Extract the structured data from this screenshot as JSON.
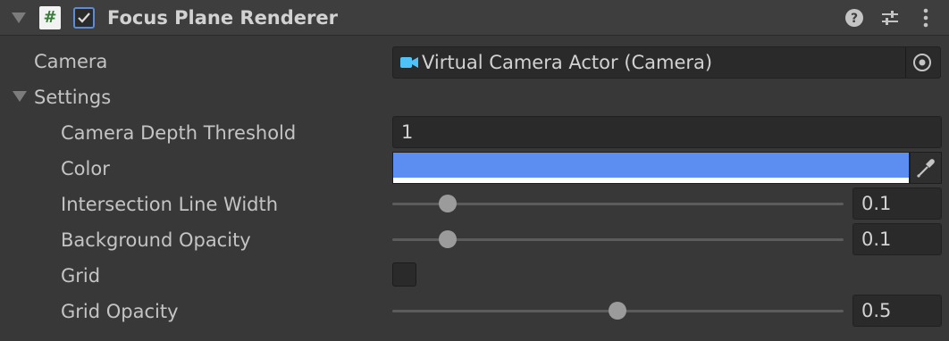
{
  "component": {
    "title": "Focus Plane Renderer",
    "enabled": true,
    "script_icon_glyph": "#"
  },
  "fields": {
    "camera": {
      "label": "Camera",
      "value": "Virtual Camera Actor (Camera)",
      "icon": "camera-icon"
    },
    "settings": {
      "label": "Settings",
      "expanded": true
    },
    "camera_depth_threshold": {
      "label": "Camera Depth Threshold",
      "value": "1"
    },
    "color": {
      "label": "Color",
      "value_hex": "#5b8ef0",
      "alpha": 1.0
    },
    "intersection_line_width": {
      "label": "Intersection Line Width",
      "value": "0.1",
      "slider_fraction": 0.11
    },
    "background_opacity": {
      "label": "Background Opacity",
      "value": "0.1",
      "slider_fraction": 0.11
    },
    "grid": {
      "label": "Grid",
      "checked": false
    },
    "grid_opacity": {
      "label": "Grid Opacity",
      "value": "0.5",
      "slider_fraction": 0.5
    }
  },
  "colors": {
    "panel_bg": "#383838",
    "header_bg": "#3e3e3e",
    "field_bg": "#2a2a2a",
    "accent": "#5d8bd6",
    "camera_icon": "#4fc3f7"
  },
  "header_icons": [
    "help-icon",
    "presets-icon",
    "more-menu-icon"
  ]
}
